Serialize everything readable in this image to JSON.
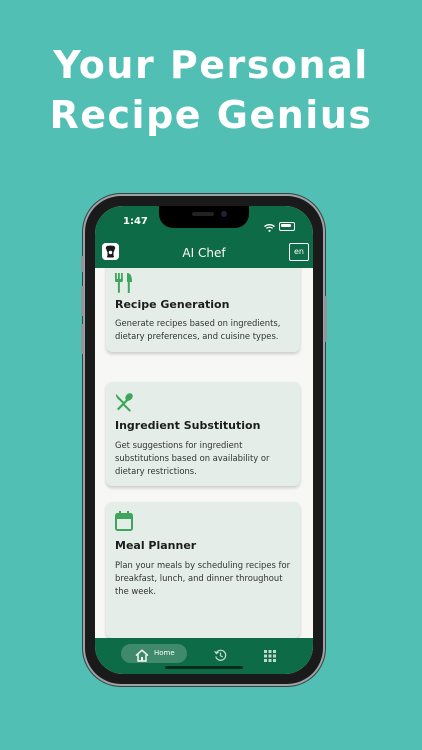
{
  "headline": {
    "line1": "Your Personal",
    "line2": "Recipe Genius"
  },
  "status_bar": {
    "time": "1:47"
  },
  "app_bar": {
    "title": "AI Chef",
    "language": "en"
  },
  "features": [
    {
      "icon": "fork-knife-icon",
      "title": "Recipe Generation",
      "description": "Generate recipes based on ingredients, dietary preferences, and cuisine types."
    },
    {
      "icon": "spoon-knife-icon",
      "title": "Ingredient Substitution",
      "description": "Get suggestions for ingredient substitutions based on availability or dietary restrictions."
    },
    {
      "icon": "calendar-icon",
      "title": "Meal Planner",
      "description": "Plan your meals by scheduling recipes for breakfast, lunch, and dinner throughout the week."
    }
  ],
  "bottom_nav": {
    "home_label": "Home",
    "items": [
      "home-icon",
      "history-icon",
      "grid-icon"
    ]
  },
  "colors": {
    "background": "#52bfb4",
    "primary": "#0e6b47",
    "card": "#e4ede7",
    "icon": "#3ea65a"
  }
}
